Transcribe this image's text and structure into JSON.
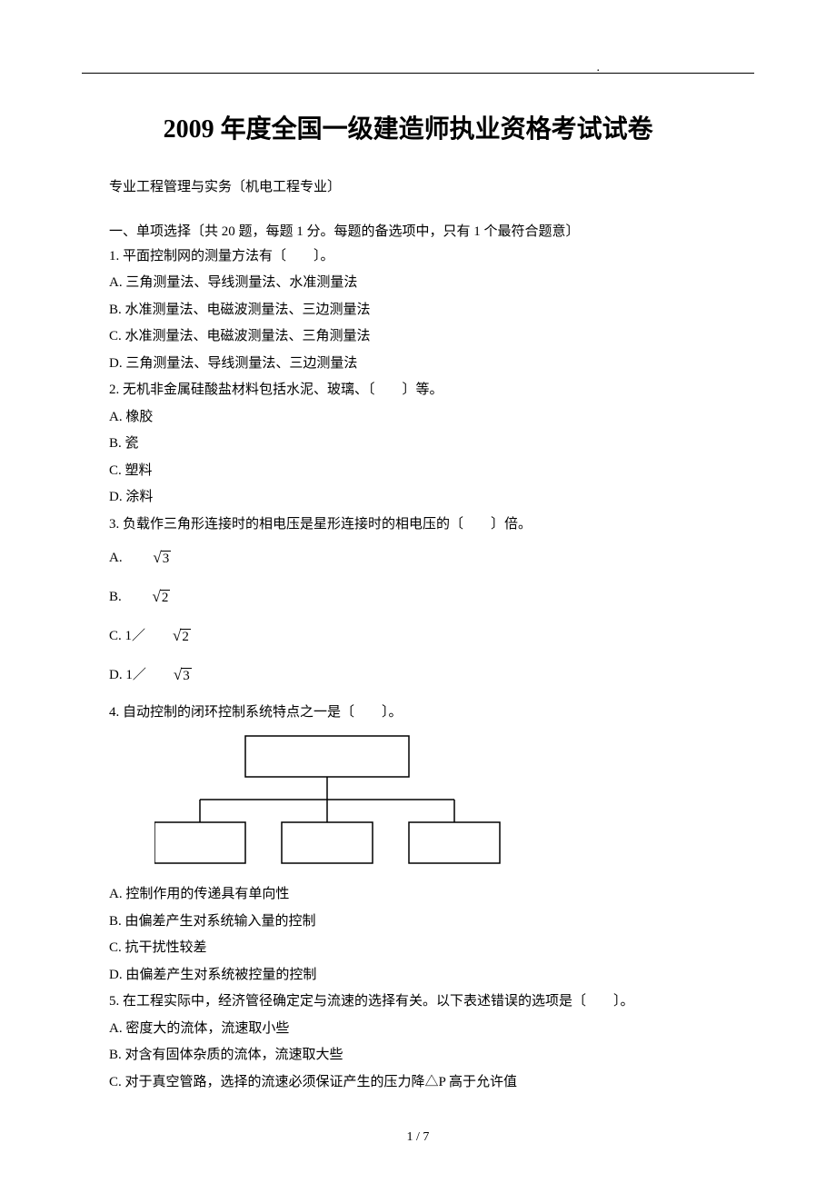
{
  "title": "2009 年度全国一级建造师执业资格考试试卷",
  "subtitle": "专业工程管理与实务〔机电工程专业〕",
  "section1_head": "一、单项选择〔共 20 题，每题 1 分。每题的备选项中，只有 1 个最符合题意〕",
  "q1": {
    "stem": "1. 平面控制网的测量方法有〔　　〕。",
    "A": "A. 三角测量法、导线测量法、水准测量法",
    "B": "B. 水准测量法、电磁波测量法、三边测量法",
    "C": "C. 水准测量法、电磁波测量法、三角测量法",
    "D": "D. 三角测量法、导线测量法、三边测量法"
  },
  "q2": {
    "stem": "2. 无机非金属硅酸盐材料包括水泥、玻璃、〔　　〕等。",
    "A": "A. 橡胶",
    "B": "B. 瓷",
    "C": "C. 塑料",
    "D": "D. 涂料"
  },
  "q3": {
    "stem": "3. 负载作三角形连接时的相电压是星形连接时的相电压的〔　　〕倍。",
    "A_prefix": "A. ",
    "A_rad": "3",
    "B_prefix": "B. ",
    "B_rad": "2",
    "C_prefix": "C. 1／",
    "C_rad": "2",
    "D_prefix": "D. 1／",
    "D_rad": "3"
  },
  "q4": {
    "stem": "4. 自动控制的闭环控制系统特点之一是〔　　〕。",
    "A": "A. 控制作用的传递具有单向性",
    "B": "B. 由偏差产生对系统输入量的控制",
    "C": "C. 抗干扰性较差",
    "D": "D. 由偏差产生对系统被控量的控制"
  },
  "q5": {
    "stem": "5. 在工程实际中，经济管径确定定与流速的选择有关。以下表述错误的选项是〔　　〕。",
    "A": "A. 密度大的流体，流速取小些",
    "B": "B. 对含有固体杂质的流体，流速取大些",
    "C": "C. 对于真空管路，选择的流速必须保证产生的压力降△P 高于允许值"
  },
  "footer": "1 / 7"
}
